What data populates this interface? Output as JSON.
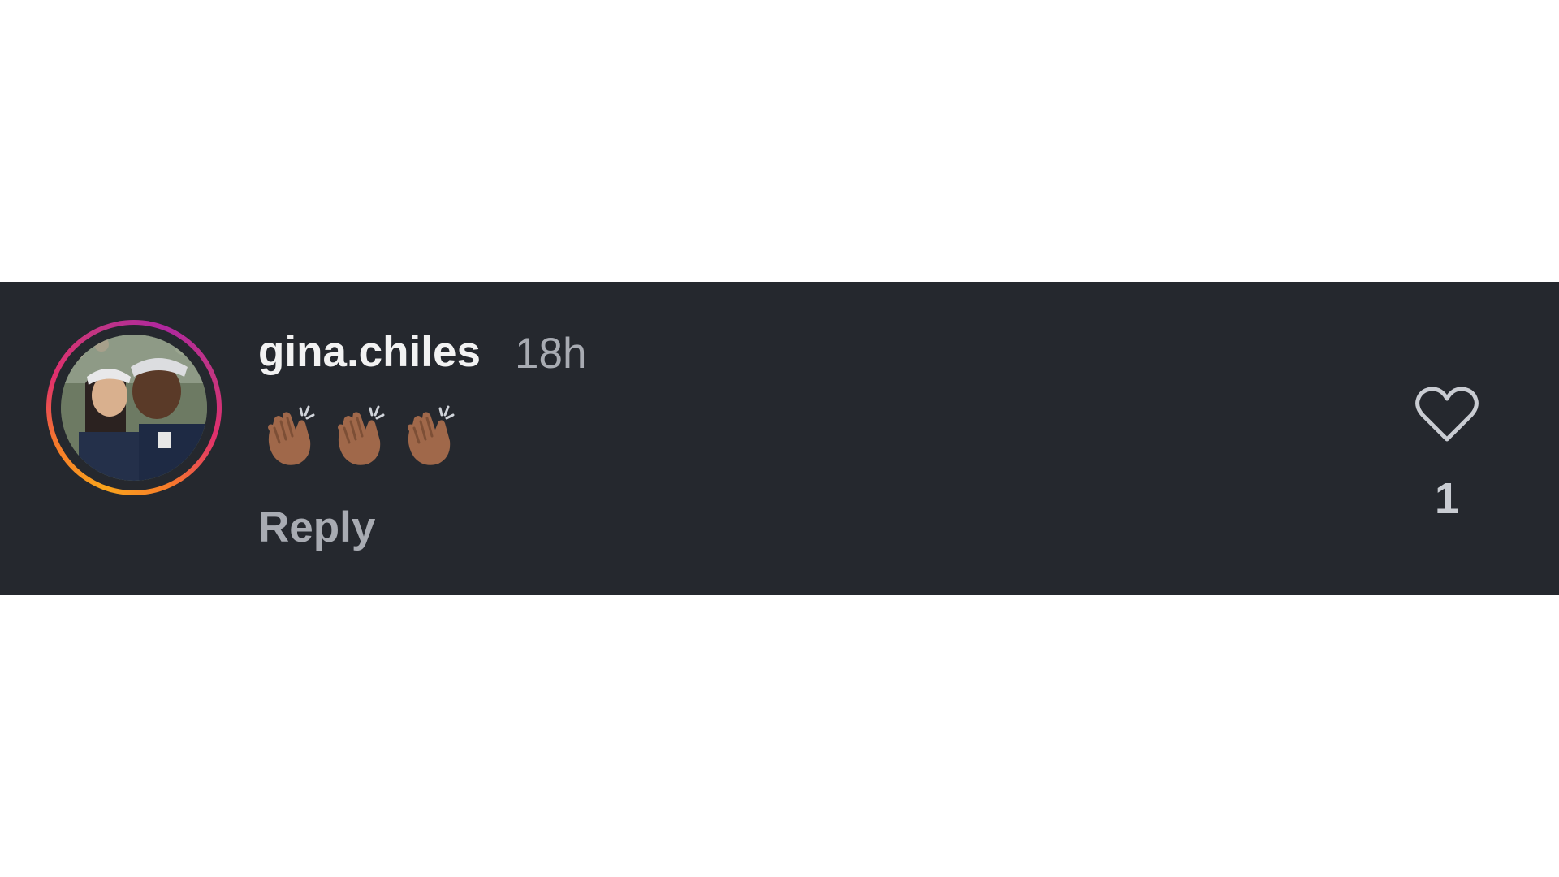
{
  "comment": {
    "username": "gina.chiles",
    "timestamp": "18h",
    "body_emoji": [
      "clapping-hands-medium-dark-skin",
      "clapping-hands-medium-dark-skin",
      "clapping-hands-medium-dark-skin"
    ],
    "reply_label": "Reply",
    "like_count": "1",
    "like_icon": "heart-outline-icon",
    "avatar_has_story_ring": true
  },
  "colors": {
    "background": "#25282e",
    "username": "#f2f2f2",
    "secondary_text": "#a8abb2",
    "story_ring_start": "#f9a41c",
    "story_ring_end": "#c13584",
    "emoji_skin": "#a0684a"
  }
}
